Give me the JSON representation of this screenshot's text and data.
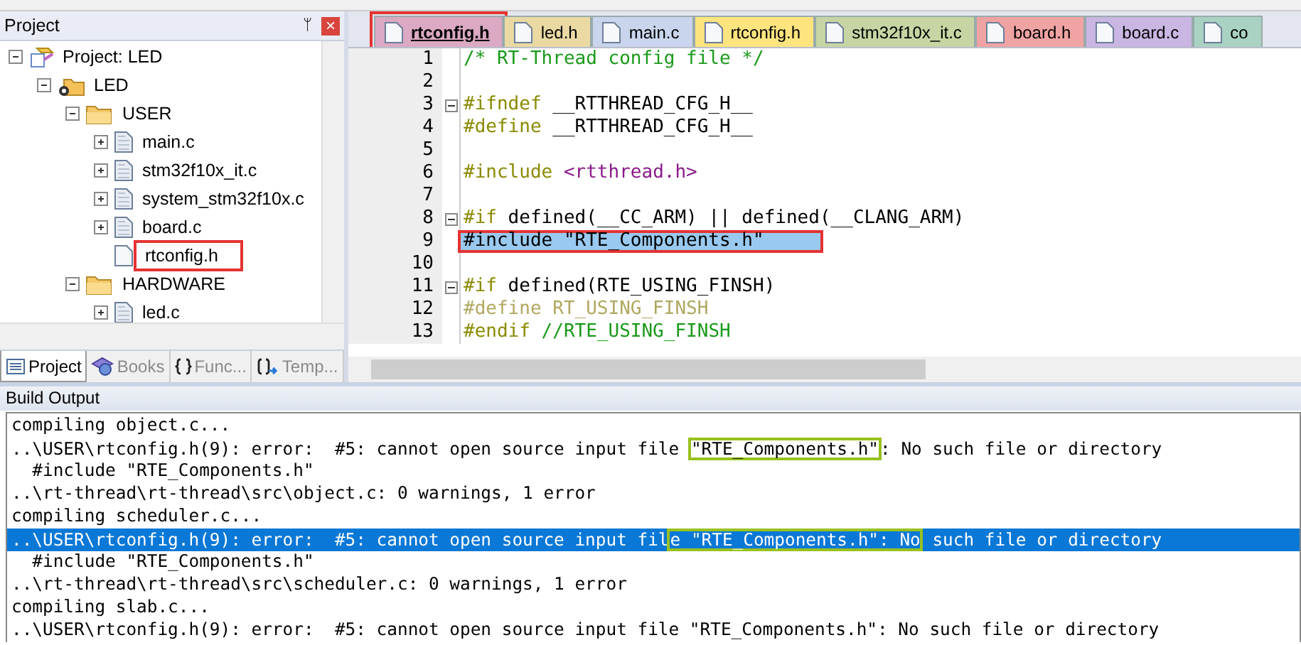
{
  "project_panel": {
    "title": "Project",
    "pin": "ᛘ",
    "close": "×",
    "tree": [
      {
        "label": "Project: LED",
        "kind": "project",
        "expanded": true,
        "children": [
          {
            "label": "LED",
            "kind": "target",
            "expanded": true,
            "children": [
              {
                "label": "USER",
                "kind": "folder",
                "expanded": true,
                "children": [
                  {
                    "label": "main.c",
                    "kind": "file",
                    "expanded": false,
                    "boxed": false
                  },
                  {
                    "label": "stm32f10x_it.c",
                    "kind": "file",
                    "expanded": false,
                    "boxed": false
                  },
                  {
                    "label": "system_stm32f10x.c",
                    "kind": "file",
                    "expanded": false,
                    "boxed": false
                  },
                  {
                    "label": "board.c",
                    "kind": "file",
                    "expanded": false,
                    "boxed": false
                  },
                  {
                    "label": "rtconfig.h",
                    "kind": "header",
                    "boxed": true
                  }
                ]
              },
              {
                "label": "HARDWARE",
                "kind": "folder",
                "expanded": true,
                "children": [
                  {
                    "label": "led.c",
                    "kind": "file",
                    "expanded": false,
                    "boxed": false
                  }
                ]
              }
            ]
          }
        ]
      }
    ],
    "bottom_tabs": [
      {
        "label": "Project",
        "kind": "project",
        "selected": true
      },
      {
        "label": "Books",
        "kind": "books",
        "selected": false
      },
      {
        "label": "Func...",
        "kind": "func",
        "selected": false
      },
      {
        "label": "Temp...",
        "kind": "temp",
        "selected": false
      }
    ]
  },
  "editor": {
    "tabs": [
      {
        "label": "rtconfig.h",
        "color": "#dba9c3",
        "selected": true,
        "boxed": true
      },
      {
        "label": "led.h",
        "color": "#ead9a3",
        "selected": false,
        "boxed": false
      },
      {
        "label": "main.c",
        "color": "#c9d5ec",
        "selected": false,
        "boxed": false
      },
      {
        "label": "rtconfig.h",
        "color": "#fde47e",
        "selected": false,
        "boxed": false
      },
      {
        "label": "stm32f10x_it.c",
        "color": "#c6d5a3",
        "selected": false,
        "boxed": false
      },
      {
        "label": "board.h",
        "color": "#f0a3a3",
        "selected": false,
        "boxed": false
      },
      {
        "label": "board.c",
        "color": "#c9b6e3",
        "selected": false,
        "boxed": false
      },
      {
        "label": "co",
        "color": "#a9d2c2",
        "selected": false,
        "boxed": false
      }
    ],
    "lines": [
      {
        "number": "1",
        "fold": false,
        "selected": false,
        "boxed": false,
        "tokens": [
          {
            "kind": "comment",
            "text": "/* RT-Thread config file */"
          }
        ]
      },
      {
        "number": "2"
      },
      {
        "number": "3",
        "fold": true,
        "selected": false,
        "boxed": false,
        "tokens": [
          {
            "kind": "directive",
            "text": "#ifndef"
          },
          {
            "kind": "plain",
            "text": " __RTTHREAD_CFG_H__"
          }
        ]
      },
      {
        "number": "4",
        "fold": false,
        "selected": false,
        "boxed": false,
        "tokens": [
          {
            "kind": "directive",
            "text": "#define"
          },
          {
            "kind": "plain",
            "text": " __RTTHREAD_CFG_H__"
          }
        ]
      },
      {
        "number": "5"
      },
      {
        "number": "6",
        "fold": false,
        "selected": false,
        "boxed": false,
        "tokens": [
          {
            "kind": "directive",
            "text": "#include"
          },
          {
            "kind": "string",
            "text": " <rtthread.h>"
          }
        ]
      },
      {
        "number": "7"
      },
      {
        "number": "8",
        "fold": true,
        "selected": false,
        "boxed": false,
        "tokens": [
          {
            "kind": "directive",
            "text": "#if"
          },
          {
            "kind": "plain",
            "text": " defined(__CC_ARM) || defined(__CLANG_ARM)"
          }
        ]
      },
      {
        "number": "9",
        "fold": false,
        "selected": true,
        "boxed": true,
        "tokens": [
          {
            "kind": "plain",
            "text": "#include \"RTE_Components.h\""
          }
        ]
      },
      {
        "number": "10"
      },
      {
        "number": "11",
        "fold": true,
        "selected": false,
        "boxed": false,
        "tokens": [
          {
            "kind": "directive",
            "text": "#if"
          },
          {
            "kind": "plain",
            "text": " defined(RTE_USING_FINSH)"
          }
        ]
      },
      {
        "number": "12",
        "fold": false,
        "selected": false,
        "boxed": false,
        "tokens": [
          {
            "kind": "inactive",
            "text": "#define RT_USING_FINSH"
          }
        ]
      },
      {
        "number": "13",
        "fold": false,
        "selected": false,
        "boxed": false,
        "tokens": [
          {
            "kind": "directive",
            "text": "#endif"
          },
          {
            "kind": "comment",
            "text": " //RTE_USING_FINSH"
          }
        ]
      }
    ]
  },
  "build_output": {
    "title": "Build Output",
    "lines": [
      {
        "selected": false,
        "parts": [
          {
            "text": "compiling object.c...",
            "boxed": false
          }
        ]
      },
      {
        "selected": false,
        "parts": [
          {
            "text": "..\\USER\\rtconfig.h(9): error:  #5: cannot open source input file ",
            "boxed": false
          },
          {
            "text": "\"RTE_Components.h\"",
            "boxed": true
          },
          {
            "text": ": No such file or directory",
            "boxed": false
          }
        ]
      },
      {
        "selected": false,
        "parts": [
          {
            "text": "  #include \"RTE_Components.h\"",
            "boxed": false
          }
        ]
      },
      {
        "selected": false,
        "parts": [
          {
            "text": "..\\rt-thread\\rt-thread\\src\\object.c: 0 warnings, 1 error",
            "boxed": false
          }
        ]
      },
      {
        "selected": false,
        "parts": [
          {
            "text": "compiling scheduler.c...",
            "boxed": false
          }
        ]
      },
      {
        "selected": true,
        "parts": [
          {
            "text": "..\\USER\\rtconfig.h(9): error:  #5: cannot open source input fil",
            "boxed": false
          },
          {
            "text": "e \"RTE_Components.h\": No",
            "boxed": true
          },
          {
            "text": " such file or directory",
            "boxed": false
          }
        ]
      },
      {
        "selected": false,
        "parts": [
          {
            "text": "  #include \"RTE_Components.h\"",
            "boxed": false
          }
        ]
      },
      {
        "selected": false,
        "parts": [
          {
            "text": "..\\rt-thread\\rt-thread\\src\\scheduler.c: 0 warnings, 1 error",
            "boxed": false
          }
        ]
      },
      {
        "selected": false,
        "parts": [
          {
            "text": "compiling slab.c...",
            "boxed": false
          }
        ]
      },
      {
        "selected": false,
        "parts": [
          {
            "text": "..\\USER\\rtconfig.h(9): error:  #5: cannot open source input file \"RTE_Components.h\": No such file or directory",
            "boxed": false
          }
        ]
      }
    ]
  }
}
